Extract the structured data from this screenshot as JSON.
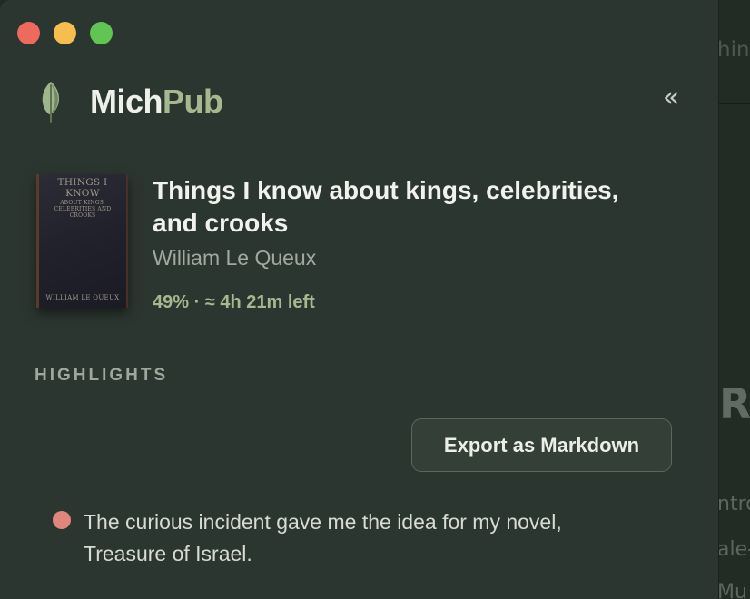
{
  "window": {
    "controls": [
      "close",
      "minimize",
      "maximize"
    ]
  },
  "brand": {
    "name_part1": "Mich",
    "name_part2": "Pub",
    "logo_icon": "leaf-icon"
  },
  "sidebar_toggle": {
    "label": "«",
    "icon": "double-chevron-left-icon"
  },
  "book": {
    "title": "Things I know about kings, celebrities, and crooks",
    "author": "William Le Queux",
    "progress_text": "49% · ≈ 4h 21m left",
    "progress_percent": 49,
    "cover": {
      "title": "THINGS I KNOW",
      "subtitle": "ABOUT KINGS, CELEBRITIES AND CROOKS",
      "author": "WILLIAM LE QUEUX"
    }
  },
  "highlights": {
    "heading": "HIGHLIGHTS",
    "export_label": "Export as Markdown",
    "items": [
      {
        "text": "The curious incident gave me the idea for my novel, Treasure of Israel.",
        "color": "#e2857a"
      }
    ]
  },
  "background_document": {
    "fragments": [
      "hing",
      "R",
      "ntro",
      "ale-",
      "Mu"
    ]
  },
  "colors": {
    "accent": "#a5b88f",
    "panel_bg": "#2c3630",
    "highlight_dot": "#e2857a"
  }
}
